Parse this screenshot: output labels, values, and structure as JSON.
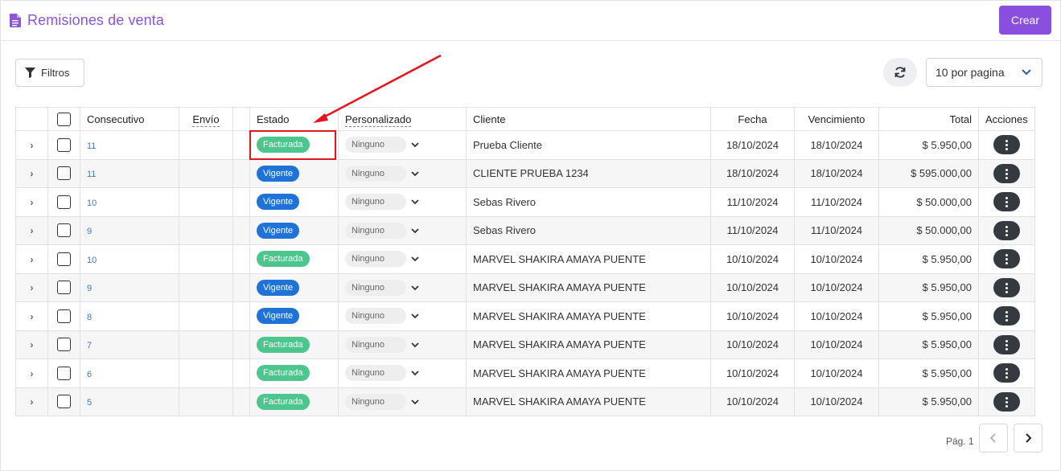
{
  "header": {
    "title": "Remisiones de venta",
    "create_label": "Crear"
  },
  "toolbar": {
    "filters_label": "Filtros",
    "per_page_value": "10 por pagina"
  },
  "table": {
    "columns": {
      "consecutivo": "Consecutivo",
      "envio": "Envío",
      "estado": "Estado",
      "personalizado": "Personalizado",
      "cliente": "Cliente",
      "fecha": "Fecha",
      "vencimiento": "Vencimiento",
      "total": "Total",
      "acciones": "Acciones"
    },
    "rows": [
      {
        "consecutivo": "11",
        "estado": "Facturada",
        "estado_type": "facturada",
        "personalizado": "Ninguno",
        "cliente": "Prueba Cliente",
        "fecha": "18/10/2024",
        "vencimiento": "18/10/2024",
        "total": "$ 5.950,00"
      },
      {
        "consecutivo": "11",
        "estado": "Vigente",
        "estado_type": "vigente",
        "personalizado": "Ninguno",
        "cliente": "CLIENTE PRUEBA 1234",
        "fecha": "18/10/2024",
        "vencimiento": "18/10/2024",
        "total": "$ 595.000,00"
      },
      {
        "consecutivo": "10",
        "estado": "Vigente",
        "estado_type": "vigente",
        "personalizado": "Ninguno",
        "cliente": "Sebas Rivero",
        "fecha": "11/10/2024",
        "vencimiento": "11/10/2024",
        "total": "$ 50.000,00"
      },
      {
        "consecutivo": "9",
        "estado": "Vigente",
        "estado_type": "vigente",
        "personalizado": "Ninguno",
        "cliente": "Sebas Rivero",
        "fecha": "11/10/2024",
        "vencimiento": "11/10/2024",
        "total": "$ 50.000,00"
      },
      {
        "consecutivo": "10",
        "estado": "Facturada",
        "estado_type": "facturada",
        "personalizado": "Ninguno",
        "cliente": "MARVEL SHAKIRA AMAYA PUENTE",
        "fecha": "10/10/2024",
        "vencimiento": "10/10/2024",
        "total": "$ 5.950,00"
      },
      {
        "consecutivo": "9",
        "estado": "Vigente",
        "estado_type": "vigente",
        "personalizado": "Ninguno",
        "cliente": "MARVEL SHAKIRA AMAYA PUENTE",
        "fecha": "10/10/2024",
        "vencimiento": "10/10/2024",
        "total": "$ 5.950,00"
      },
      {
        "consecutivo": "8",
        "estado": "Vigente",
        "estado_type": "vigente",
        "personalizado": "Ninguno",
        "cliente": "MARVEL SHAKIRA AMAYA PUENTE",
        "fecha": "10/10/2024",
        "vencimiento": "10/10/2024",
        "total": "$ 5.950,00"
      },
      {
        "consecutivo": "7",
        "estado": "Facturada",
        "estado_type": "facturada",
        "personalizado": "Ninguno",
        "cliente": "MARVEL SHAKIRA AMAYA PUENTE",
        "fecha": "10/10/2024",
        "vencimiento": "10/10/2024",
        "total": "$ 5.950,00"
      },
      {
        "consecutivo": "6",
        "estado": "Facturada",
        "estado_type": "facturada",
        "personalizado": "Ninguno",
        "cliente": "MARVEL SHAKIRA AMAYA PUENTE",
        "fecha": "10/10/2024",
        "vencimiento": "10/10/2024",
        "total": "$ 5.950,00"
      },
      {
        "consecutivo": "5",
        "estado": "Facturada",
        "estado_type": "facturada",
        "personalizado": "Ninguno",
        "cliente": "MARVEL SHAKIRA AMAYA PUENTE",
        "fecha": "10/10/2024",
        "vencimiento": "10/10/2024",
        "total": "$ 5.950,00"
      }
    ]
  },
  "pagination": {
    "label": "Pág. 1"
  },
  "icons": {
    "title": "document-icon",
    "filters": "filter-icon",
    "refresh": "refresh-icon",
    "per_page": "chevron-down-icon",
    "row_expand": "chevron-right-icon",
    "row_actions": "more-vertical-icon",
    "prev": "chevron-left-icon",
    "next": "chevron-right-icon"
  },
  "colors": {
    "accent": "#8a4fdf",
    "title": "#8b55d6",
    "facturada": "#4cc68d",
    "vigente": "#1f72d8",
    "annotation": "#e8141c"
  }
}
